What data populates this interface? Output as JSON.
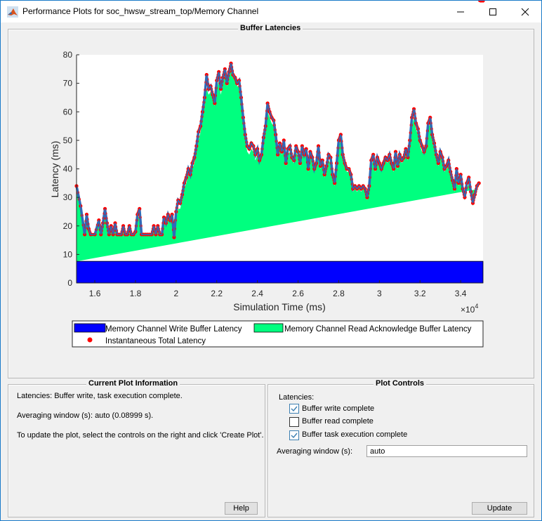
{
  "window": {
    "title": "Performance Plots for soc_hwsw_stream_top/Memory Channel",
    "minimize_label": "minimize",
    "maximize_label": "maximize",
    "close_label": "close"
  },
  "buffer_panel": {
    "title": "Buffer Latencies"
  },
  "chart_data": {
    "type": "area",
    "title": "",
    "xlabel": "Simulation Time (ms)",
    "ylabel": "Latency (ms)",
    "x_exponent_label": "×10^4",
    "xlim": [
      1.51,
      3.51
    ],
    "ylim": [
      0,
      80
    ],
    "x_ticks": [
      1.6,
      1.8,
      2,
      2.2,
      2.4,
      2.6,
      2.8,
      3,
      3.2,
      3.4
    ],
    "x_tick_labels": [
      "1.6",
      "1.8",
      "2",
      "2.2",
      "2.4",
      "2.6",
      "2.8",
      "3",
      "3.2",
      "3.4"
    ],
    "y_ticks": [
      0,
      10,
      20,
      30,
      40,
      50,
      60,
      70,
      80
    ],
    "y_tick_labels": [
      "0",
      "10",
      "20",
      "30",
      "40",
      "50",
      "60",
      "70",
      "80"
    ],
    "grid": false,
    "legend_position": "bottom",
    "series": [
      {
        "name": "Memory Channel Write Buffer Latency",
        "kind": "stacked-area",
        "color": "#0000ff",
        "constant_value": 7.6
      },
      {
        "name": "Memory Channel Read Acknowledge Buffer Latency",
        "kind": "stacked-area",
        "color": "#00ff7f"
      },
      {
        "name": "Instantaneous Total Latency",
        "kind": "scatter",
        "color": "#ff0000"
      }
    ],
    "x": [
      1.51,
      1.53,
      1.55,
      1.56,
      1.57,
      1.58,
      1.6,
      1.62,
      1.63,
      1.64,
      1.65,
      1.66,
      1.67,
      1.68,
      1.69,
      1.7,
      1.71,
      1.72,
      1.73,
      1.74,
      1.75,
      1.76,
      1.77,
      1.78,
      1.79,
      1.8,
      1.81,
      1.82,
      1.83,
      1.84,
      1.85,
      1.86,
      1.87,
      1.88,
      1.89,
      1.9,
      1.91,
      1.92,
      1.93,
      1.94,
      1.95,
      1.96,
      1.97,
      1.98,
      1.99,
      2.0,
      2.01,
      2.02,
      2.03,
      2.04,
      2.05,
      2.06,
      2.07,
      2.08,
      2.09,
      2.1,
      2.11,
      2.12,
      2.13,
      2.14,
      2.15,
      2.16,
      2.17,
      2.18,
      2.19,
      2.2,
      2.21,
      2.22,
      2.23,
      2.24,
      2.25,
      2.26,
      2.27,
      2.28,
      2.29,
      2.3,
      2.31,
      2.32,
      2.33,
      2.34,
      2.35,
      2.36,
      2.37,
      2.38,
      2.39,
      2.4,
      2.41,
      2.42,
      2.43,
      2.44,
      2.45,
      2.46,
      2.47,
      2.48,
      2.49,
      2.5,
      2.51,
      2.52,
      2.53,
      2.54,
      2.55,
      2.56,
      2.57,
      2.58,
      2.59,
      2.6,
      2.61,
      2.62,
      2.63,
      2.64,
      2.65,
      2.66,
      2.67,
      2.68,
      2.69,
      2.7,
      2.71,
      2.72,
      2.73,
      2.74,
      2.75,
      2.76,
      2.77,
      2.78,
      2.79,
      2.8,
      2.81,
      2.82,
      2.83,
      2.84,
      2.85,
      2.86,
      2.87,
      2.88,
      2.89,
      2.9,
      2.91,
      2.92,
      2.93,
      2.94,
      2.95,
      2.96,
      2.97,
      2.98,
      2.99,
      3.0,
      3.01,
      3.02,
      3.03,
      3.04,
      3.05,
      3.06,
      3.07,
      3.08,
      3.09,
      3.1,
      3.11,
      3.12,
      3.13,
      3.14,
      3.15,
      3.16,
      3.17,
      3.18,
      3.19,
      3.2,
      3.21,
      3.22,
      3.23,
      3.24,
      3.25,
      3.26,
      3.27,
      3.28,
      3.29,
      3.3,
      3.31,
      3.32,
      3.33,
      3.34,
      3.35,
      3.36,
      3.37,
      3.38,
      3.39,
      3.4,
      3.41,
      3.42,
      3.43,
      3.44,
      3.45,
      3.46,
      3.47,
      3.48,
      3.49,
      3.5,
      3.51
    ],
    "total_latency": [
      34,
      27,
      17,
      24,
      19,
      17,
      17,
      22,
      17,
      21,
      26,
      21,
      17,
      20,
      17,
      21,
      17,
      17,
      17,
      20,
      17,
      17,
      20,
      17,
      17,
      18,
      24,
      26,
      17,
      17,
      17,
      17,
      17,
      17,
      20,
      17,
      20,
      17,
      17,
      23,
      21,
      24,
      22,
      24,
      16,
      25,
      29,
      28,
      31,
      35,
      37,
      40,
      38,
      42,
      44,
      48,
      53,
      55,
      60,
      65,
      73,
      68,
      69,
      66,
      63,
      71,
      74,
      68,
      72,
      75,
      70,
      74,
      77,
      73,
      72,
      70,
      71,
      65,
      58,
      52,
      48,
      47,
      49,
      48,
      45,
      47,
      43,
      45,
      51,
      55,
      63,
      60,
      58,
      57,
      52,
      45,
      49,
      46,
      50,
      42,
      47,
      48,
      44,
      43,
      48,
      46,
      42,
      48,
      45,
      47,
      40,
      46,
      44,
      40,
      42,
      48,
      41,
      43,
      38,
      41,
      45,
      44,
      38,
      35,
      42,
      50,
      52,
      45,
      42,
      40,
      40,
      38,
      33,
      34,
      33,
      34,
      33,
      34,
      33,
      30,
      34,
      43,
      45,
      40,
      44,
      42,
      40,
      42,
      44,
      43,
      45,
      42,
      40,
      46,
      41,
      45,
      43,
      44,
      47,
      44,
      50,
      58,
      61,
      56,
      54,
      50,
      48,
      46,
      48,
      56,
      58,
      52,
      49,
      45,
      42,
      46,
      44,
      40,
      41,
      43,
      39,
      36,
      33,
      40,
      35,
      38,
      33,
      30,
      35,
      37,
      32,
      28,
      31,
      34,
      35
    ],
    "read_ack_top": [
      33,
      26,
      17,
      22,
      18,
      17,
      17,
      21,
      17,
      20,
      24,
      20,
      17,
      19,
      17,
      19,
      17,
      17,
      17,
      19,
      17,
      17,
      19,
      17,
      17,
      17,
      22,
      24,
      17,
      17,
      17,
      17,
      17,
      17,
      19,
      17,
      19,
      17,
      17,
      21,
      20,
      22,
      21,
      22,
      16,
      22,
      26,
      26,
      29,
      33,
      35,
      38,
      37,
      40,
      42,
      46,
      50,
      53,
      58,
      62,
      68,
      66,
      67,
      65,
      62,
      68,
      71,
      66,
      70,
      73,
      69,
      72,
      75,
      72,
      71,
      69,
      69,
      63,
      56,
      50,
      46,
      45,
      47,
      46,
      43,
      45,
      42,
      44,
      49,
      53,
      60,
      58,
      56,
      55,
      50,
      44,
      47,
      45,
      48,
      41,
      45,
      46,
      43,
      42,
      46,
      44,
      41,
      46,
      44,
      45,
      39,
      44,
      43,
      39,
      41,
      46,
      40,
      42,
      37,
      40,
      43,
      42,
      37,
      34,
      40,
      48,
      50,
      43,
      41,
      39,
      39,
      37,
      32,
      33,
      32,
      33,
      32,
      33,
      32,
      29,
      33,
      41,
      43,
      39,
      42,
      41,
      39,
      41,
      43,
      42,
      43,
      41,
      39,
      44,
      40,
      43,
      42,
      43,
      45,
      43,
      48,
      55,
      58,
      54,
      52,
      48,
      46,
      45,
      47,
      54,
      56,
      50,
      47,
      44,
      41,
      44,
      43,
      39,
      40,
      41,
      38,
      35,
      32,
      38,
      34,
      36,
      32,
      29,
      33,
      35,
      31,
      27,
      30,
      33,
      33
    ]
  },
  "legend": {
    "items": [
      {
        "label": "Memory Channel Write Buffer Latency",
        "color": "#0000ff"
      },
      {
        "label": "Memory Channel Read Acknowledge Buffer Latency",
        "color": "#00ff7f"
      },
      {
        "label": "Instantaneous Total Latency",
        "color": "#ff0000"
      }
    ]
  },
  "info_panel": {
    "title": "Current Plot Information",
    "lines": [
      "Latencies: Buffer write, task execution complete.",
      "Averaging window (s): auto (0.08999 s).",
      "To update the plot, select the controls on the right and click 'Create Plot'."
    ],
    "help_label": "Help"
  },
  "controls_panel": {
    "title": "Plot Controls",
    "latencies_label": "Latencies:",
    "checkboxes": [
      {
        "label": "Buffer write complete",
        "checked": true
      },
      {
        "label": "Buffer read complete",
        "checked": false
      },
      {
        "label": "Buffer task execution complete",
        "checked": true
      }
    ],
    "averaging_label": "Averaging window (s):",
    "averaging_value": "auto",
    "update_label": "Update"
  }
}
